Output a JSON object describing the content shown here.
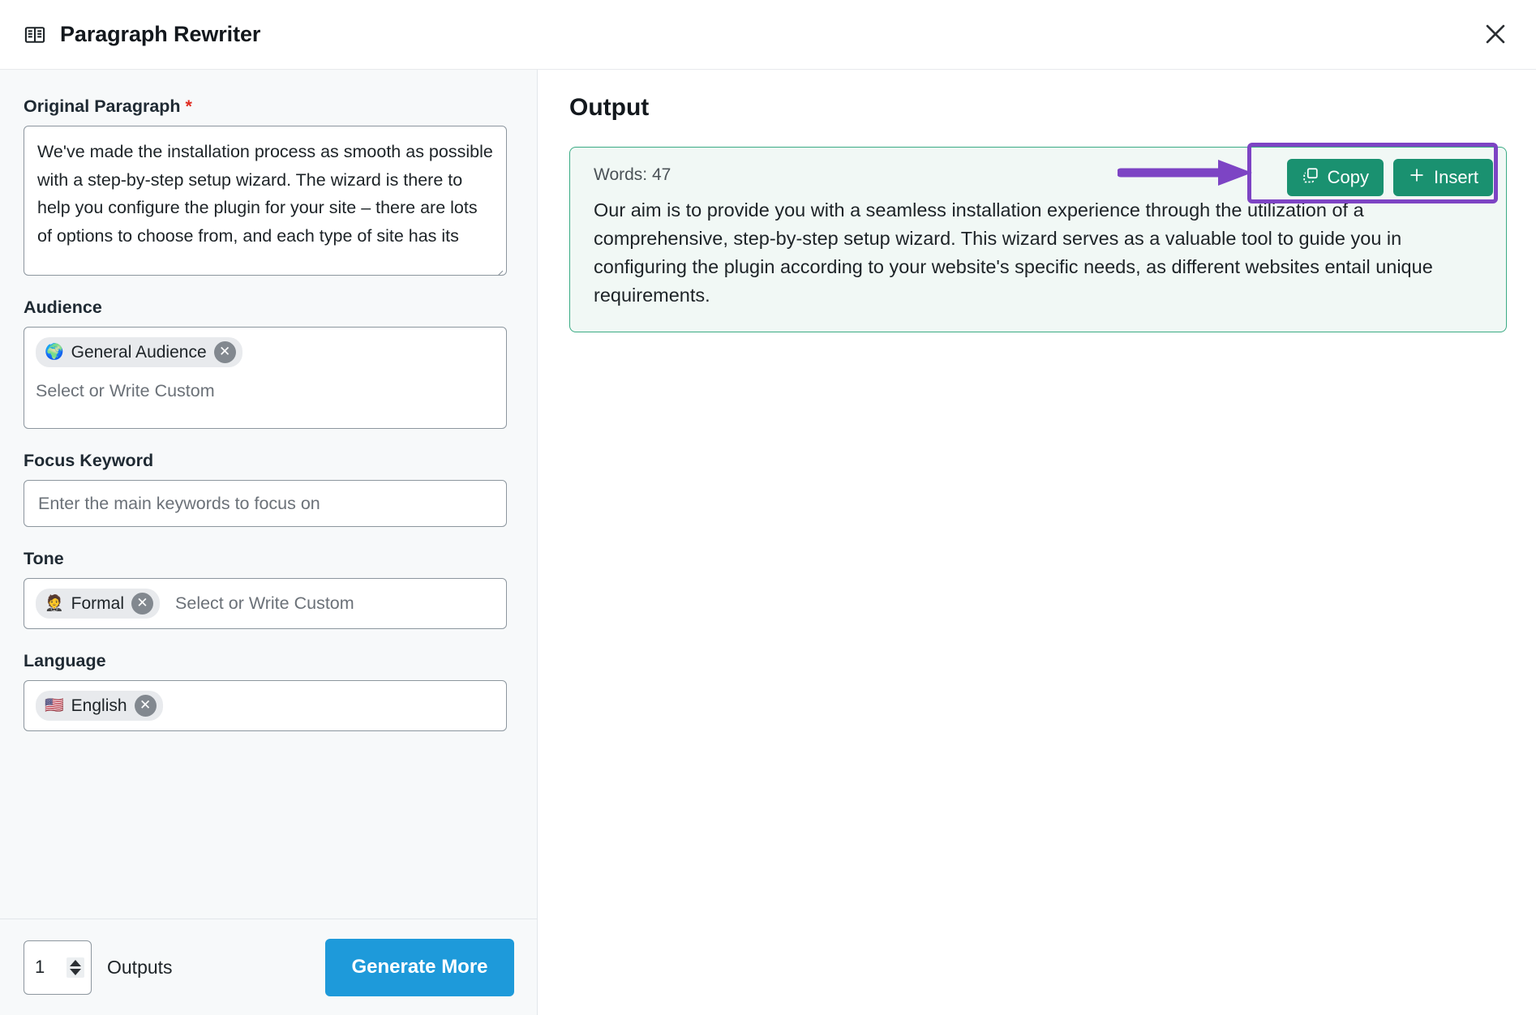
{
  "header": {
    "title": "Paragraph Rewriter",
    "icon": "book-open-icon",
    "close_label": "×"
  },
  "form": {
    "original_paragraph": {
      "label": "Original Paragraph",
      "required_marker": "*",
      "value": "We've made the installation process as smooth as possible with a step-by-step setup wizard. The wizard is there to help you configure the plugin for your site – there are lots of options to choose from, and each type of site has its"
    },
    "audience": {
      "label": "Audience",
      "chips": [
        {
          "emoji": "🌍",
          "text": "General Audience"
        }
      ],
      "placeholder": "Select or Write Custom"
    },
    "focus_keyword": {
      "label": "Focus Keyword",
      "value": "",
      "placeholder": "Enter the main keywords to focus on"
    },
    "tone": {
      "label": "Tone",
      "chips": [
        {
          "emoji": "🤵",
          "text": "Formal"
        }
      ],
      "placeholder": "Select or Write Custom"
    },
    "language": {
      "label": "Language",
      "chips": [
        {
          "emoji": "🇺🇸",
          "text": "English"
        }
      ]
    }
  },
  "footer": {
    "outputs_count": "1",
    "outputs_label": "Outputs",
    "generate_label": "Generate More"
  },
  "output": {
    "title": "Output",
    "words_label": "Words: 47",
    "text": "Our aim is to provide you with a seamless installation experience through the utilization of a comprehensive, step-by-step setup wizard. This wizard serves as a valuable tool to guide you in configuring the plugin according to your website's specific needs, as different websites entail unique requirements.",
    "copy_label": "Copy",
    "insert_label": "Insert"
  },
  "colors": {
    "accent_blue": "#1e9ada",
    "accent_green": "#1a9170",
    "card_border_green": "#3aab84",
    "card_bg_green": "#f1f8f5",
    "annotation_purple": "#7d44c4",
    "required_red": "#e02b20"
  }
}
